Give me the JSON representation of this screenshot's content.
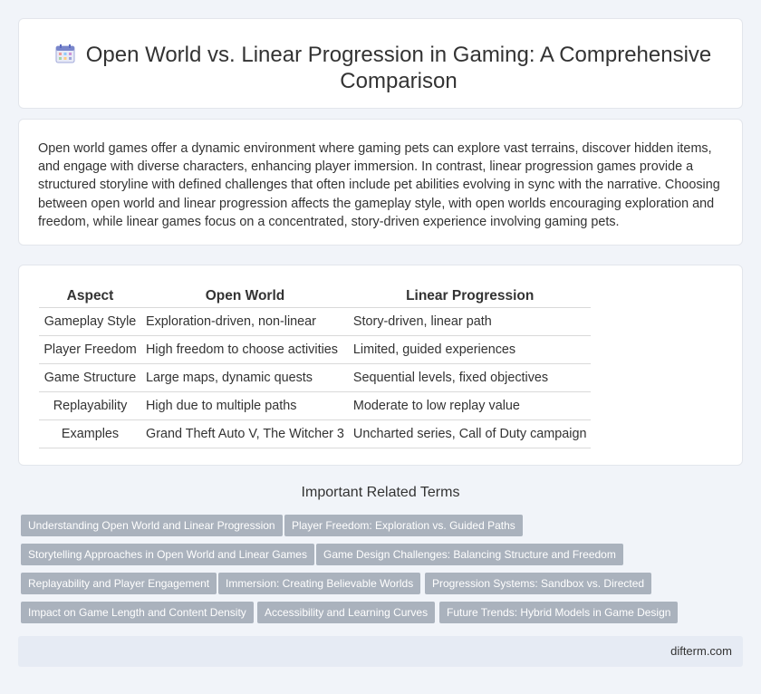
{
  "header": {
    "title": "Open World vs. Linear Progression in Gaming: A Comprehensive Comparison",
    "icon": "calendar-grid-icon"
  },
  "intro": {
    "text": "Open world games offer a dynamic environment where gaming pets can explore vast terrains, discover hidden items, and engage with diverse characters, enhancing player immersion. In contrast, linear progression games provide a structured storyline with defined challenges that often include pet abilities evolving in sync with the narrative. Choosing between open world and linear progression affects the gameplay style, with open worlds encouraging exploration and freedom, while linear games focus on a concentrated, story-driven experience involving gaming pets."
  },
  "table": {
    "headers": [
      "Aspect",
      "Open World",
      "Linear Progression"
    ],
    "rows": [
      [
        "Gameplay Style",
        "Exploration-driven, non-linear",
        "Story-driven, linear path"
      ],
      [
        "Player Freedom",
        "High freedom to choose activities",
        "Limited, guided experiences"
      ],
      [
        "Game Structure",
        "Large maps, dynamic quests",
        "Sequential levels, fixed objectives"
      ],
      [
        "Replayability",
        "High due to multiple paths",
        "Moderate to low replay value"
      ],
      [
        "Examples",
        "Grand Theft Auto V, The Witcher 3",
        "Uncharted series, Call of Duty campaign"
      ]
    ]
  },
  "related": {
    "heading": "Important Related Terms",
    "tags": [
      "Understanding Open World and Linear Progression",
      "Player Freedom: Exploration vs. Guided Paths",
      "Storytelling Approaches in Open World and Linear Games",
      "Game Design Challenges: Balancing Structure and Freedom",
      "Replayability and Player Engagement",
      "Immersion: Creating Believable Worlds",
      "Progression Systems: Sandbox vs. Directed",
      "Impact on Game Length and Content Density",
      "Accessibility and Learning Curves",
      "Future Trends: Hybrid Models in Game Design"
    ]
  },
  "footer": {
    "site": "difterm.com"
  },
  "colors": {
    "background": "#f1f4f9",
    "tag": "#aab2bd",
    "footer": "#e6ebf4"
  }
}
